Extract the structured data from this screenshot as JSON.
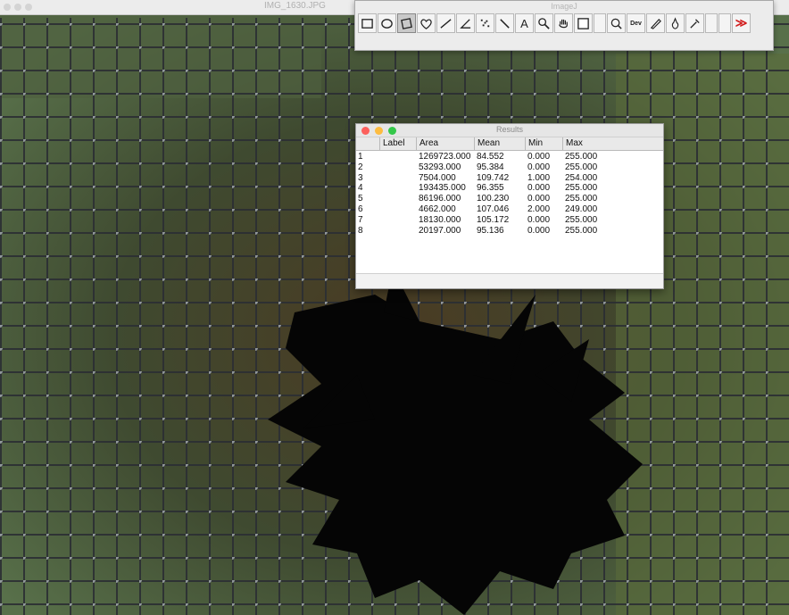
{
  "image_window": {
    "title": "IMG_1630.JPG"
  },
  "imagej_window": {
    "title": "ImageJ",
    "tools": [
      {
        "name": "rectangle-tool-icon",
        "glyph": ""
      },
      {
        "name": "oval-tool-icon",
        "glyph": ""
      },
      {
        "name": "polygon-tool-icon",
        "glyph": ""
      },
      {
        "name": "freehand-tool-icon",
        "glyph": ""
      },
      {
        "name": "straight-line-tool-icon",
        "glyph": ""
      },
      {
        "name": "angle-tool-icon",
        "glyph": ""
      },
      {
        "name": "point-tool-icon",
        "glyph": ""
      },
      {
        "name": "wand-tool-icon",
        "glyph": ""
      },
      {
        "name": "text-tool-icon",
        "glyph": "A"
      },
      {
        "name": "magnifier-tool-icon",
        "glyph": ""
      },
      {
        "name": "scroll-tool-icon",
        "glyph": ""
      },
      {
        "name": "color-picker-tool-icon",
        "glyph": ""
      },
      {
        "name": "zoom-tool-icon",
        "glyph": ""
      },
      {
        "name": "developer-menu-icon",
        "glyph": "Dev"
      },
      {
        "name": "pencil-tool-icon",
        "glyph": ""
      },
      {
        "name": "brush-tool-icon",
        "glyph": ""
      },
      {
        "name": "dropper-tool-icon",
        "glyph": ""
      },
      {
        "name": "more-tools-icon",
        "glyph": "≫"
      }
    ]
  },
  "results_window": {
    "title": "Results",
    "columns": [
      "",
      "Label",
      "Area",
      "Mean",
      "Min",
      "Max"
    ],
    "rows": [
      {
        "index": "1",
        "label": "",
        "area": "1269723.000",
        "mean": "84.552",
        "min": "0.000",
        "max": "255.000"
      },
      {
        "index": "2",
        "label": "",
        "area": "53293.000",
        "mean": "95.384",
        "min": "0.000",
        "max": "255.000"
      },
      {
        "index": "3",
        "label": "",
        "area": "7504.000",
        "mean": "109.742",
        "min": "1.000",
        "max": "254.000"
      },
      {
        "index": "4",
        "label": "",
        "area": "193435.000",
        "mean": "96.355",
        "min": "0.000",
        "max": "255.000"
      },
      {
        "index": "5",
        "label": "",
        "area": "86196.000",
        "mean": "100.230",
        "min": "0.000",
        "max": "255.000"
      },
      {
        "index": "6",
        "label": "",
        "area": "4662.000",
        "mean": "107.046",
        "min": "2.000",
        "max": "249.000"
      },
      {
        "index": "7",
        "label": "",
        "area": "18130.000",
        "mean": "105.172",
        "min": "0.000",
        "max": "255.000"
      },
      {
        "index": "8",
        "label": "",
        "area": "20197.000",
        "mean": "95.136",
        "min": "0.000",
        "max": "255.000"
      }
    ]
  },
  "colors": {
    "close": "#fc605c",
    "minimize": "#fdbc40",
    "zoom": "#34c84a",
    "more_tools": "#d21d1d"
  }
}
